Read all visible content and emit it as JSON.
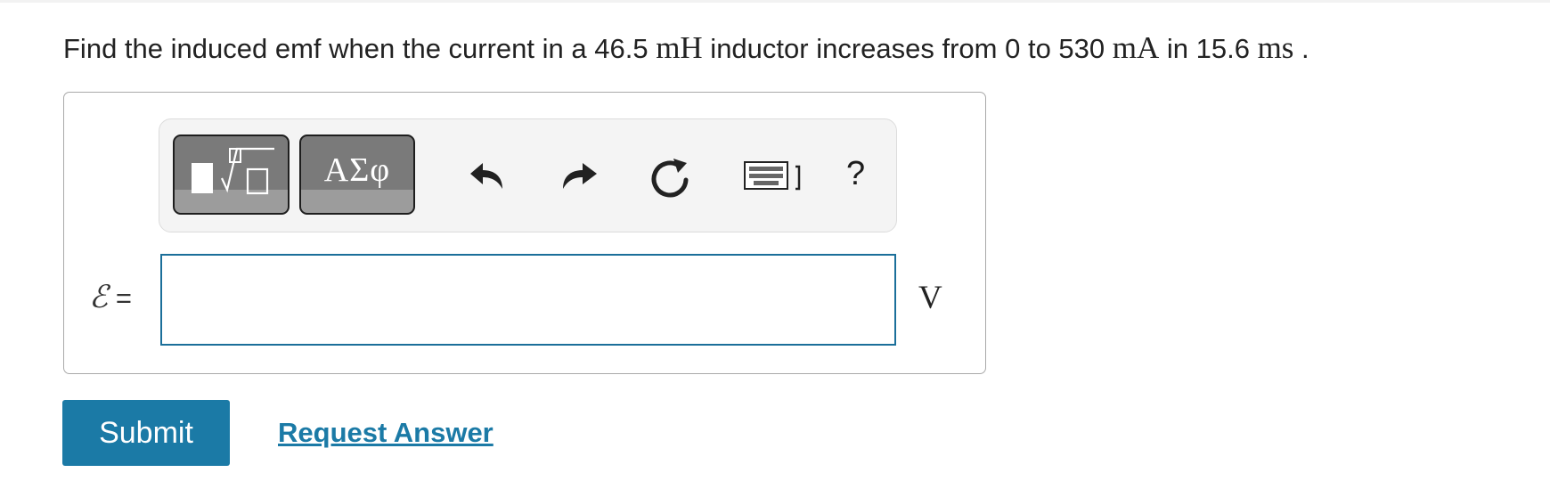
{
  "question": {
    "part1": "Find the induced emf when the current in a 46.5 ",
    "unit_inductance": "mH",
    "part2": " inductor increases from 0 to 530 ",
    "unit_current": "mA",
    "part3": " in 15.6 ",
    "unit_time": "ms",
    "part4": " ."
  },
  "toolbar": {
    "symbols_label": "ΑΣφ",
    "help_label": "?",
    "icons": [
      "templates-icon",
      "undo-icon",
      "redo-icon",
      "reset-icon",
      "keyboard-icon",
      "help-icon"
    ]
  },
  "answer": {
    "variable_symbol": "ℰ",
    "equals": " =",
    "value": "",
    "unit": "V"
  },
  "actions": {
    "submit_label": "Submit",
    "request_answer_label": "Request Answer"
  },
  "colors": {
    "accent": "#1b7aa6",
    "input_border": "#1b6f9a",
    "toolbar_button": "#7a7a7a"
  }
}
